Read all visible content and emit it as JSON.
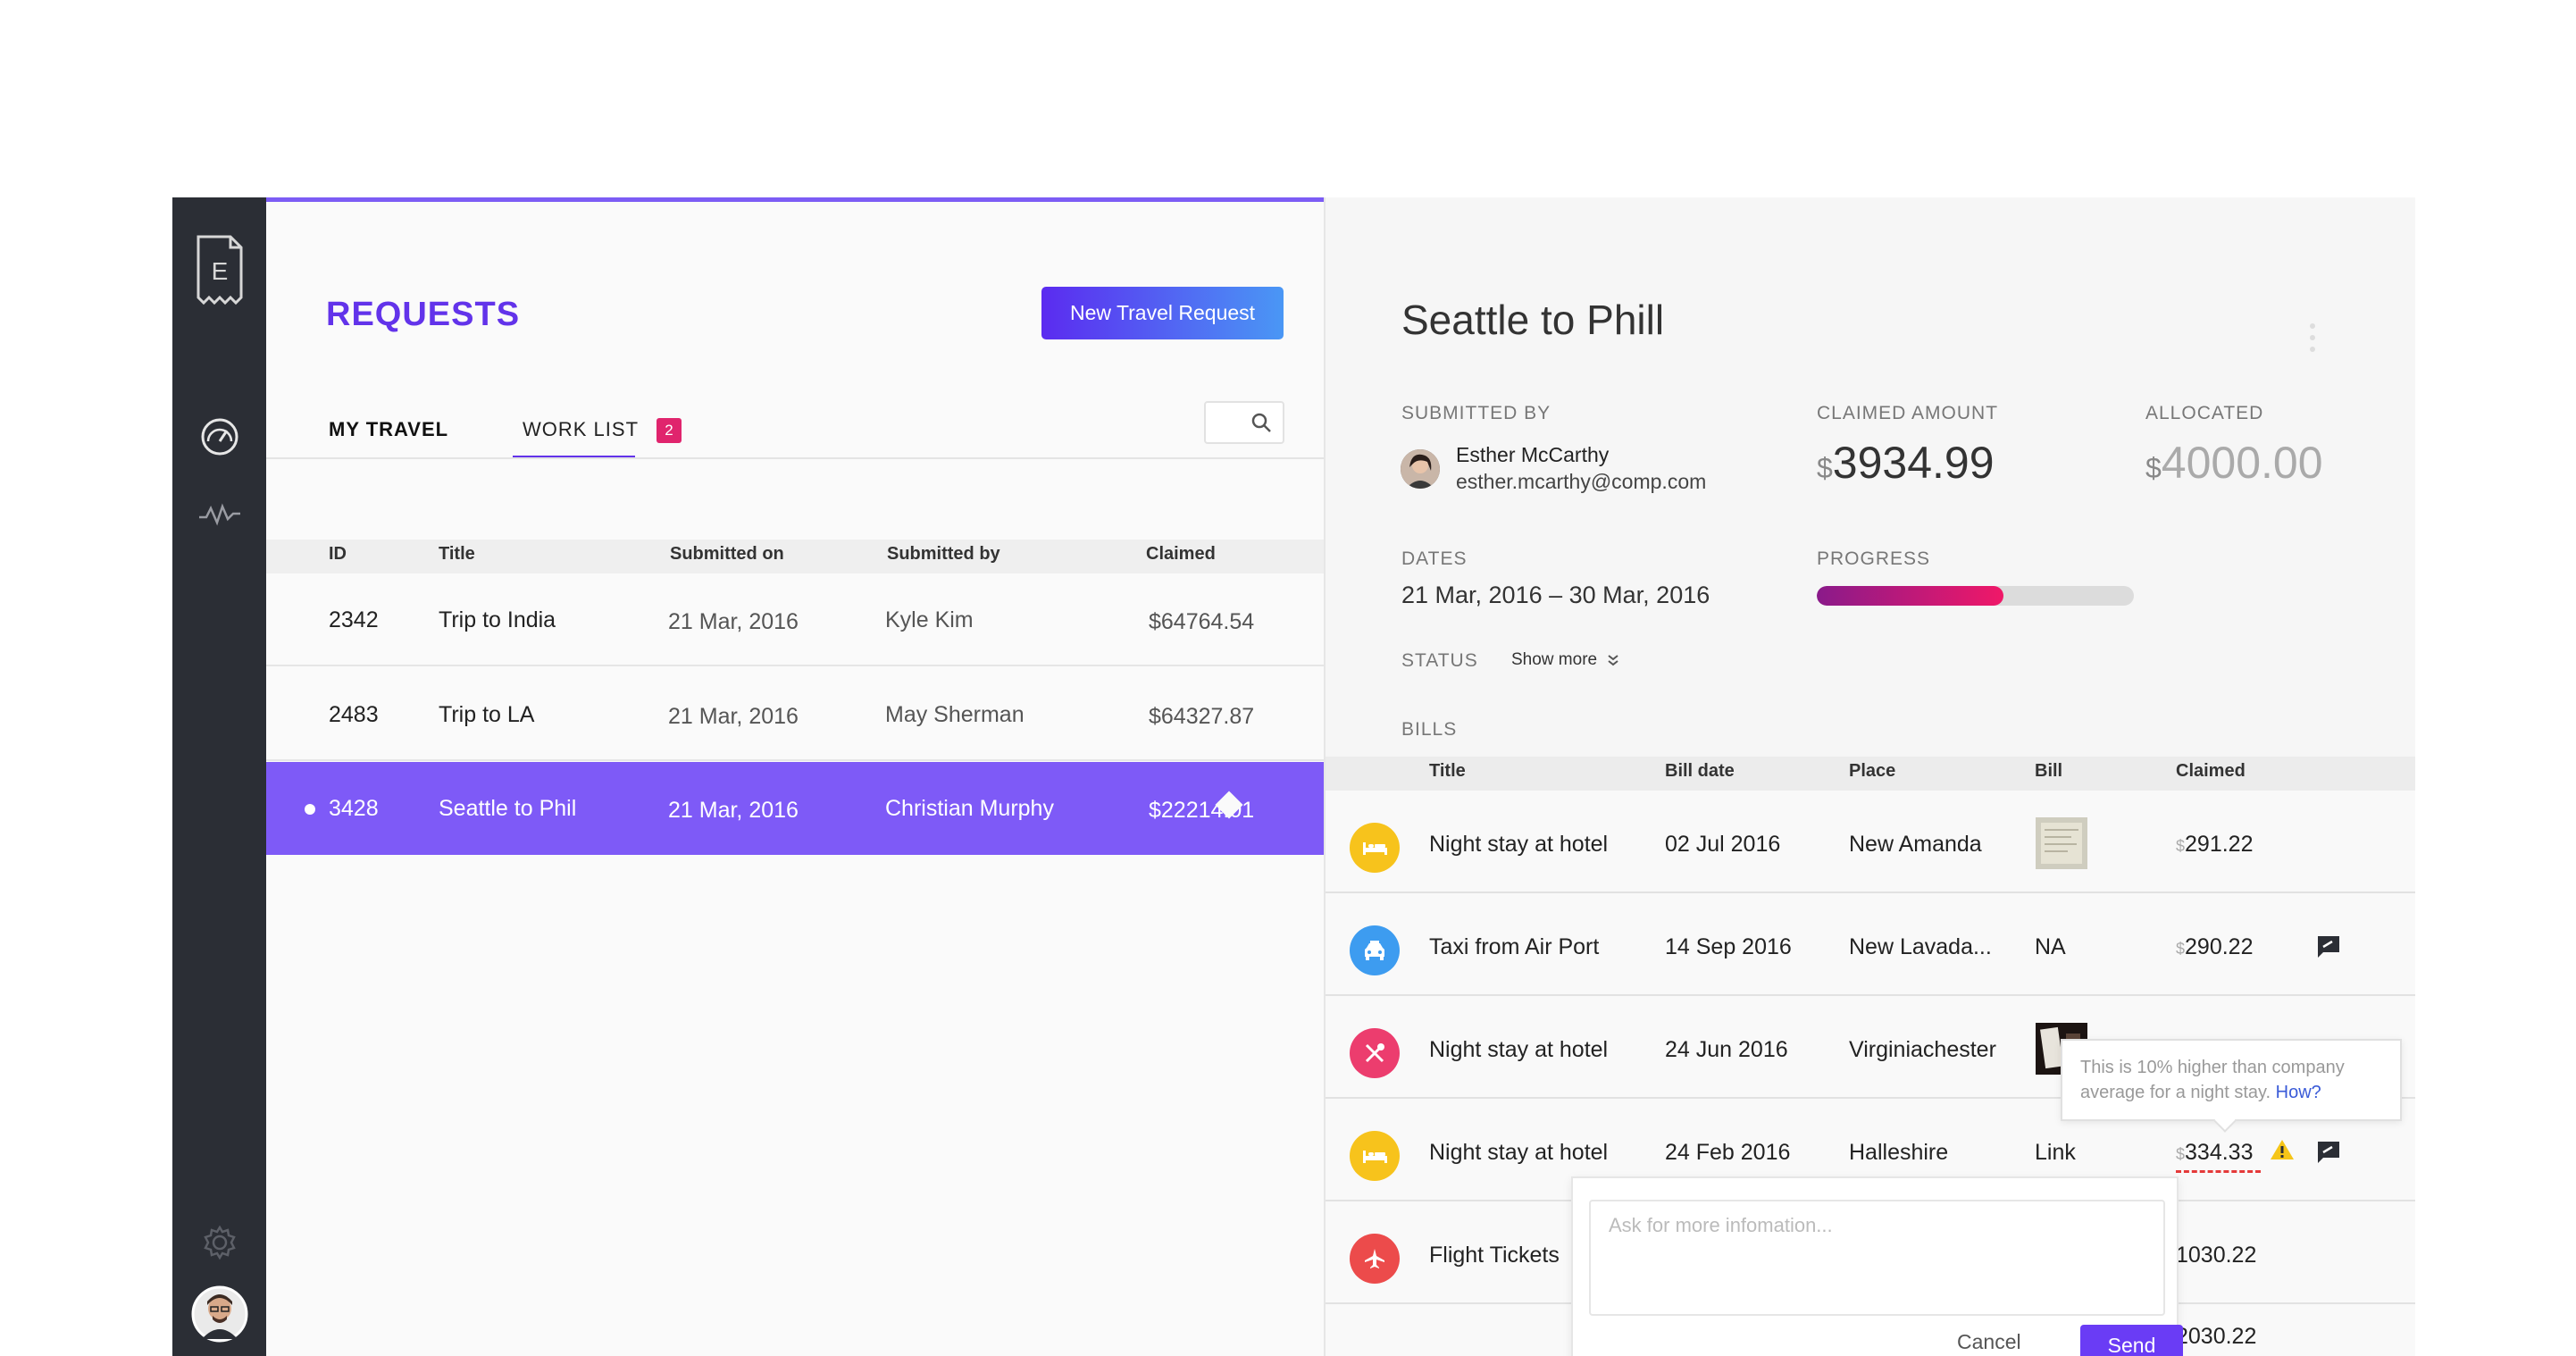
{
  "colors": {
    "accent": "#6233ea",
    "selected_row": "#7e5af7",
    "sidebar": "#2b2e35",
    "badge": "#e0246d",
    "progress_start": "#8a1a8a",
    "progress_end": "#f01868"
  },
  "sidebar": {
    "logo_letter": "E",
    "icons": [
      "receipt-logo-icon",
      "dashboard-gauge-icon",
      "activity-pulse-icon",
      "settings-gear-icon",
      "user-avatar"
    ]
  },
  "requests": {
    "title": "REQUESTS",
    "new_button": "New Travel Request",
    "tabs": {
      "my_travel": "MY TRAVEL",
      "work_list": "WORK LIST",
      "work_list_badge": "2"
    },
    "columns": {
      "id": "ID",
      "title": "Title",
      "submitted_on": "Submitted on",
      "submitted_by": "Submitted by",
      "claimed": "Claimed"
    },
    "rows": [
      {
        "id": "2342",
        "title": "Trip to India",
        "submitted_on": "21 Mar, 2016",
        "submitted_by": "Kyle Kim",
        "claimed": "$64764.54"
      },
      {
        "id": "2483",
        "title": "Trip to LA",
        "submitted_on": "21 Mar, 2016",
        "submitted_by": "May Sherman",
        "claimed": "$64327.87"
      },
      {
        "id": "3428",
        "title": "Seattle to Phil",
        "submitted_on": "21 Mar, 2016",
        "submitted_by": "Christian Murphy",
        "claimed": "$22214.01"
      }
    ]
  },
  "detail": {
    "title": "Seattle to Phill",
    "submitted_by_label": "SUBMITTED BY",
    "submitter_name": "Esther McCarthy",
    "submitter_email": "esther.mcarthy@comp.com",
    "claimed_label": "CLAIMED AMOUNT",
    "claimed_currency": "$",
    "claimed_value": "3934.99",
    "allocated_label": "ALLOCATED",
    "allocated_currency": "$",
    "allocated_value": "4000.00",
    "dates_label": "DATES",
    "dates_value": "21 Mar, 2016 – 30 Mar, 2016",
    "progress_label": "PROGRESS",
    "progress_fraction": 0.59,
    "status_label": "STATUS",
    "show_more": "Show more",
    "bills_label": "BILLS"
  },
  "bills": {
    "columns": {
      "title": "Title",
      "bill_date": "Bill date",
      "place": "Place",
      "bill": "Bill",
      "claimed": "Claimed"
    },
    "rows": [
      {
        "icon": "hotel-bed-icon",
        "icon_color": "#f7c31c",
        "title": "Night stay at hotel",
        "date": "02 Jul 2016",
        "place": "New Amanda",
        "bill": "",
        "currency": "$",
        "claimed": "291.22"
      },
      {
        "icon": "taxi-icon",
        "icon_color": "#3d9cf0",
        "title": "Taxi from Air Port",
        "date": "14 Sep 2016",
        "place": "New Lavada...",
        "bill": "NA",
        "currency": "$",
        "claimed": "290.22"
      },
      {
        "icon": "restaurant-cutlery-icon",
        "icon_color": "#ec3d6e",
        "title": "Night stay at hotel",
        "date": "24 Jun 2016",
        "place": "Virginiachester",
        "bill": "",
        "currency": "",
        "claimed": ""
      },
      {
        "icon": "hotel-bed-icon",
        "icon_color": "#f7c31c",
        "title": "Night stay at hotel",
        "date": "24 Feb 2016",
        "place": "Halleshire",
        "bill": "Link",
        "currency": "$",
        "claimed": "334.33"
      },
      {
        "icon": "airplane-icon",
        "icon_color": "#ec4b4b",
        "title": "Flight Tickets",
        "date": "",
        "place": "",
        "bill": "",
        "currency": "",
        "claimed": "1030.22"
      },
      {
        "icon": "",
        "icon_color": "",
        "title": "",
        "date": "",
        "place": "",
        "bill": "",
        "currency": "",
        "claimed": "2030.22"
      }
    ]
  },
  "tooltip": {
    "text": "This is 10% higher than company average for a night stay.",
    "link": "How?"
  },
  "comment": {
    "placeholder": "Ask for more infomation...",
    "cancel": "Cancel",
    "send": "Send"
  }
}
